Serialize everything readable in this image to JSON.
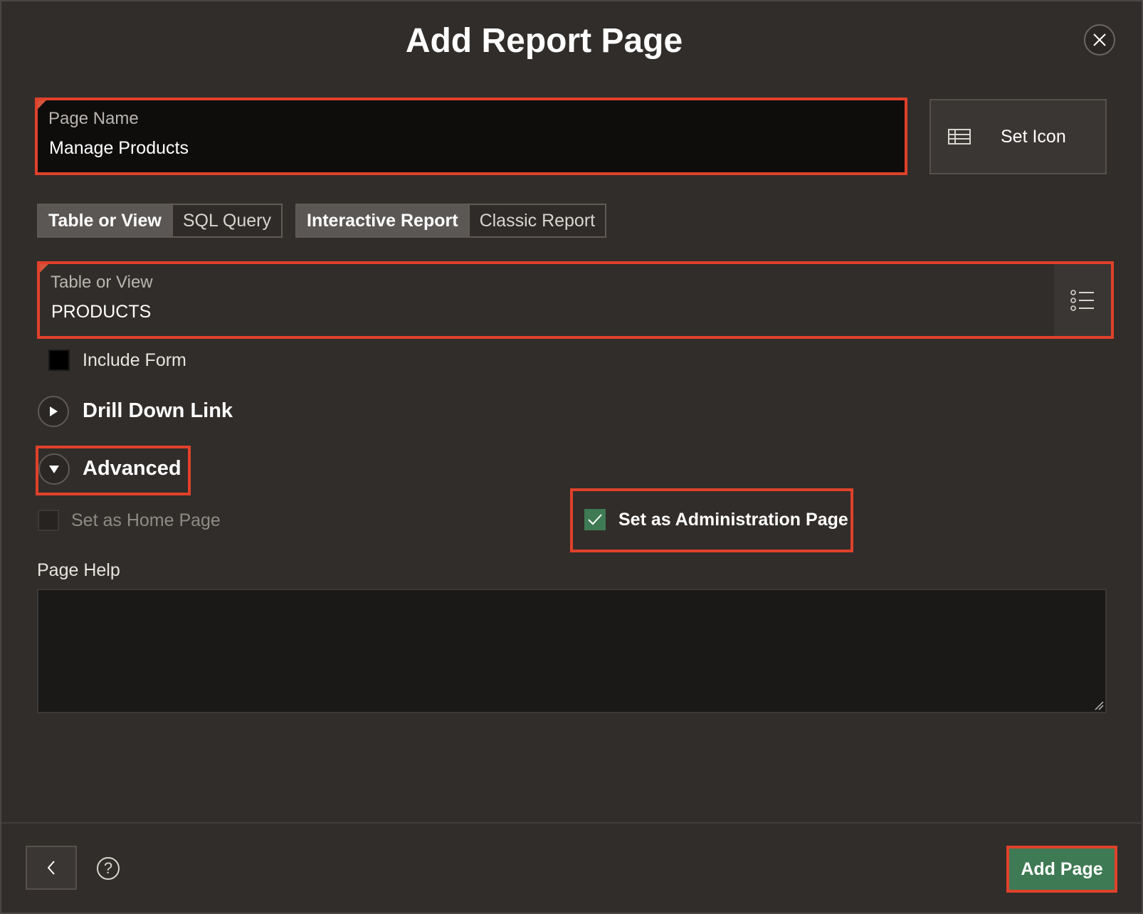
{
  "dialog": {
    "title": "Add Report Page",
    "close_icon": "close-icon"
  },
  "page_name": {
    "label": "Page Name",
    "value": "Manage Products"
  },
  "set_icon": {
    "label": "Set Icon",
    "icon": "table-grid-icon"
  },
  "source_toggle": {
    "options": [
      "Table or View",
      "SQL Query"
    ],
    "selected": "Table or View"
  },
  "report_type_toggle": {
    "options": [
      "Interactive Report",
      "Classic Report"
    ],
    "selected": "Interactive Report"
  },
  "table_or_view": {
    "label": "Table or View",
    "value": "PRODUCTS",
    "list_icon": "list-icon"
  },
  "include_form": {
    "label": "Include Form",
    "checked": false
  },
  "drill_down": {
    "label": "Drill Down Link",
    "expanded": false
  },
  "advanced": {
    "label": "Advanced",
    "expanded": true
  },
  "home_page": {
    "label": "Set as Home Page",
    "checked": false,
    "disabled": true
  },
  "admin_page": {
    "label": "Set as Administration Page",
    "checked": true
  },
  "page_help": {
    "label": "Page Help",
    "value": ""
  },
  "footer": {
    "back_icon": "chevron-left-icon",
    "help_icon": "?",
    "add_label": "Add Page"
  },
  "colors": {
    "background": "#312d2a",
    "highlight": "#e0412b",
    "primary": "#3e7a53"
  }
}
